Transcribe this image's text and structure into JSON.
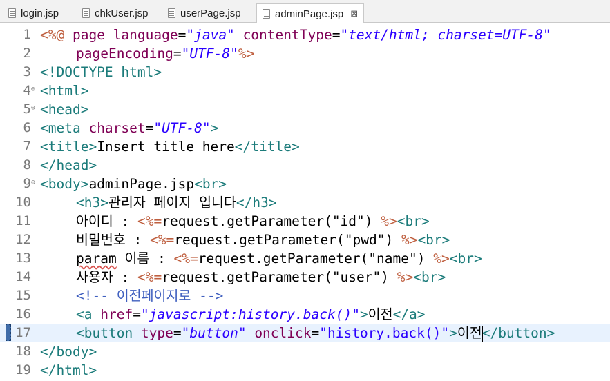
{
  "tabs": [
    {
      "label": "login.jsp",
      "active": false
    },
    {
      "label": "chkUser.jsp",
      "active": false
    },
    {
      "label": "userPage.jsp",
      "active": false
    },
    {
      "label": "adminPage.jsp",
      "active": true
    }
  ],
  "tab_close_glyph": "⊠",
  "colors": {
    "tag": "#1b7b7a",
    "attribute": "#7f0055",
    "attr_value": "#2a00ff",
    "jsp_delim": "#bf5f3f",
    "comment": "#3f5fbf",
    "current_line": "#e8f2fe"
  },
  "editor": {
    "line_numbers": [
      "1",
      "2",
      "3",
      "4",
      "5",
      "6",
      "7",
      "8",
      "9",
      "10",
      "11",
      "12",
      "13",
      "14",
      "15",
      "16",
      "17",
      "18",
      "19"
    ],
    "fold_marker": "⊖",
    "t": {
      "l1_open": "<%@",
      "l1_page": " page ",
      "l1_lang": "language",
      "l1_eq1": "=",
      "l1_java": "\"java\"",
      "l1_sp": " ",
      "l1_ct": "contentType",
      "l1_eq2": "=",
      "l1_ctv": "\"text/html; charset=UTF-8\"",
      "l2_pe": "pageEncoding",
      "l2_eq": "=",
      "l2_pev": "\"UTF-8\"",
      "l2_close": "%>",
      "l3_doctype": "<!DOCTYPE html>",
      "l4_html": "<html>",
      "l5_head": "<head>",
      "l6_meta": "<meta ",
      "l6_charset": "charset",
      "l6_eq": "=",
      "l6_val": "\"UTF-8\"",
      "l6_end": ">",
      "l7_open": "<title>",
      "l7_text": "Insert title here",
      "l7_close": "</title>",
      "l8_head_close": "</head>",
      "l9_body": "<body>",
      "l9_text": "adminPage.jsp",
      "l9_br": "<br>",
      "l10_open": "<h3>",
      "l10_text": "관리자 페이지 입니다",
      "l10_close": "</h3>",
      "l11_label": "아이디 : ",
      "l11_open": "<%=",
      "l11_code": "request.getParameter(\"id\") ",
      "l11_close": "%>",
      "l11_br": "<br>",
      "l12_label": "비밀번호 : ",
      "l12_open": "<%=",
      "l12_code": "request.getParameter(\"pwd\") ",
      "l12_close": "%>",
      "l12_br": "<br>",
      "l13_param": "param",
      "l13_label": " 이름 : ",
      "l13_open": "<%=",
      "l13_code": "request.getParameter(\"name\") ",
      "l13_close": "%>",
      "l13_br": "<br>",
      "l14_label": "사용자 : ",
      "l14_open": "<%=",
      "l14_code": "request.getParameter(\"user\") ",
      "l14_close": "%>",
      "l14_br": "<br>",
      "l15_comment": "<!-- 이전페이지로 -->",
      "l16_a": "<a ",
      "l16_href": "href",
      "l16_eq": "=",
      "l16_val": "\"javascript:history.back()\"",
      "l16_gt": ">",
      "l16_text": "이전",
      "l16_close": "</a>",
      "l17_btn": "<button ",
      "l17_type": "type",
      "l17_eq1": "=",
      "l17_typev": "\"button\"",
      "l17_sp": " ",
      "l17_onclick": "onclick",
      "l17_eq2": "=",
      "l17_onclickv": "\"history.back()\"",
      "l17_gt": ">",
      "l17_text": "이전",
      "l17_close": "</button>",
      "l18_body_close": "</body>",
      "l19_html_close": "</html>"
    }
  }
}
